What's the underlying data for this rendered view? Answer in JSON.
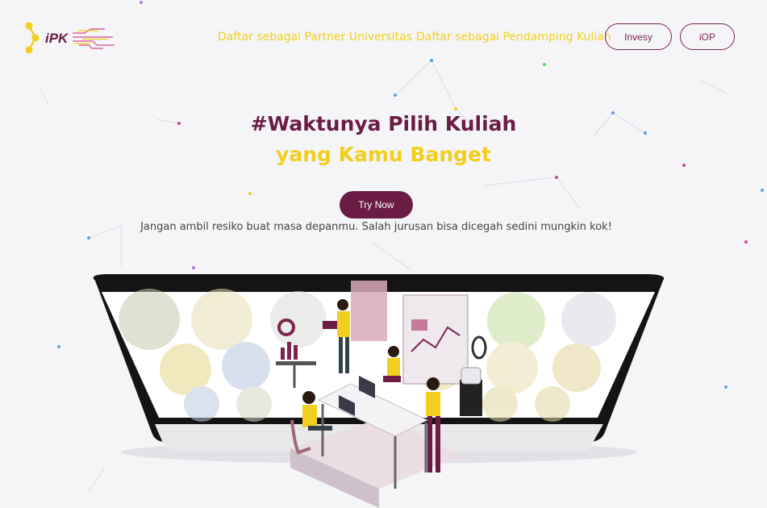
{
  "header": {
    "logo_text": "iPK",
    "nav": {
      "partner_univ": "Daftar sebagai Partner Universitas",
      "pendamping": "Daftar sebagai Pendamping Kuliah"
    },
    "buttons": {
      "invesy": "Invesy",
      "iop": "iOP"
    }
  },
  "hero": {
    "title_line1": "#Waktunya Pilih Kuliah",
    "title_line2": "yang Kamu Banget",
    "cta": "Try Now",
    "subtitle": "Jangan ambil resiko buat masa depanmu. Salah jurusan bisa dicegah sedini mungkin kok!"
  },
  "colors": {
    "primary": "#6a1c45",
    "accent": "#f2cf1e",
    "background": "#f5f5f7"
  }
}
